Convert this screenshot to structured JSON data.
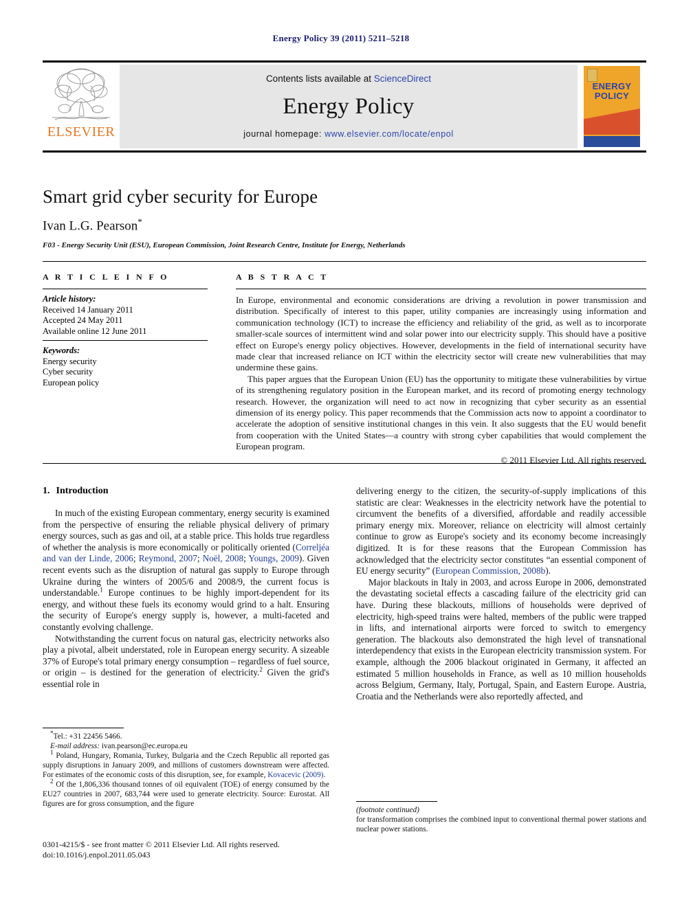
{
  "running_head": "Energy Policy 39 (2011) 5211–5218",
  "masthead": {
    "publisher_name": "ELSEVIER",
    "contents_prefix": "Contents lists available at ",
    "contents_link": "ScienceDirect",
    "journal_name": "Energy Policy",
    "homepage_prefix": "journal homepage: ",
    "homepage_url": "www.elsevier.com/locate/enpol",
    "cover_title_line1": "ENERGY",
    "cover_title_line2": "POLICY"
  },
  "article": {
    "title": "Smart grid cyber security for Europe",
    "author": "Ivan L.G. Pearson",
    "author_marker": "*",
    "affiliation": "F03 - Energy Security Unit (ESU), European Commission, Joint Research Centre, Institute for Energy, Netherlands"
  },
  "article_info": {
    "heading": "A R T I C L E  I N F O",
    "history_label": "Article history:",
    "history": [
      "Received 14 January 2011",
      "Accepted 24 May 2011",
      "Available online 12 June 2011"
    ],
    "keywords_label": "Keywords:",
    "keywords": [
      "Energy security",
      "Cyber security",
      "European policy"
    ]
  },
  "abstract": {
    "heading": "A B S T R A C T",
    "paragraph1": "In Europe, environmental and economic considerations are driving a revolution in power transmission and distribution. Specifically of interest to this paper, utility companies are increasingly using information and communication technology (ICT) to increase the efficiency and reliability of the grid, as well as to incorporate smaller-scale sources of intermittent wind and solar power into our electricity supply. This should have a positive effect on Europe's energy policy objectives. However, developments in the field of international security have made clear that increased reliance on ICT within the electricity sector will create new vulnerabilities that may undermine these gains.",
    "paragraph2": "This paper argues that the European Union (EU) has the opportunity to mitigate these vulnerabilities by virtue of its strengthening regulatory position in the European market, and its record of promoting energy technology research. However, the organization will need to act now in recognizing that cyber security as an essential dimension of its energy policy. This paper recommends that the Commission acts now to appoint a coordinator to accelerate the adoption of sensitive institutional changes in this vein. It also suggests that the EU would benefit from cooperation with the United States—a country with strong cyber capabilities that would complement the European program.",
    "copyright": "© 2011 Elsevier Ltd. All rights reserved."
  },
  "body": {
    "section_number": "1.",
    "section_title": "Introduction",
    "left_p1_a": "In much of the existing European commentary, energy security is examined from the perspective of ensuring the reliable physical delivery of primary energy sources, such as gas and oil, at a stable price. This holds true regardless of whether the analysis is more economically or politically oriented (",
    "left_p1_cite1": "Correljéa and van der Linde, 2006",
    "left_p1_sep1": "; ",
    "left_p1_cite2": "Reymond, 2007",
    "left_p1_sep2": "; ",
    "left_p1_cite3": "Noël, 2008",
    "left_p1_sep3": "; ",
    "left_p1_cite4": "Youngs, 2009",
    "left_p1_b": "). Given recent events such as the disruption of natural gas supply to Europe through Ukraine during the winters of 2005/6 and 2008/9, the current focus is understandable.",
    "left_p1_sup": "1",
    "left_p1_c": " Europe continues to be highly import-dependent for its energy, and without these fuels its economy would grind to a halt. Ensuring the security of Europe's energy supply is, however, a multi-faceted and constantly evolving challenge.",
    "left_p2_a": "Notwithstanding the current focus on natural gas, electricity networks also play a pivotal, albeit understated, role in European energy security. A sizeable 37% of Europe's total primary energy consumption – regardless of fuel source, or origin – is destined for the generation of electricity.",
    "left_p2_sup": "2",
    "left_p2_b": " Given the grid's essential role in",
    "right_p1_a": "delivering energy to the citizen, the security-of-supply implications of this statistic are clear: Weaknesses in the electricity network have the potential to circumvent the benefits of a diversified, affordable and readily accessible primary energy mix. Moreover, reliance on electricity will almost certainly continue to grow as Europe's society and its economy become increasingly digitized. It is for these reasons that the European Commission has acknowledged that the electricity sector constitutes “an essential component of EU energy security” (",
    "right_p1_cite": "European Commission, 2008b",
    "right_p1_b": ").",
    "right_p2": "Major blackouts in Italy in 2003, and across Europe in 2006, demonstrated the devastating societal effects a cascading failure of the electricity grid can have. During these blackouts, millions of households were deprived of electricity, high-speed trains were halted, members of the public were trapped in lifts, and international airports were forced to switch to emergency generation. The blackouts also demonstrated the high level of transnational interdependency that exists in the European electricity transmission system. For example, although the 2006 blackout originated in Germany, it affected an estimated 5 million households in France, as well as 10 million households across Belgium, Germany, Italy, Portugal, Spain, and Eastern Europe. Austria, Croatia and the Netherlands were also reportedly affected, and"
  },
  "footnotes": {
    "tel_marker": "*",
    "tel": "Tel.: +31 22456 5466.",
    "email_label": "E-mail address:",
    "email": "ivan.pearson@ec.europa.eu",
    "fn1_marker": "1",
    "fn1_a": "Poland, Hungary, Romania, Turkey, Bulgaria and the Czech Republic all reported gas supply disruptions in January 2009, and millions of customers downstream were affected. For estimates of the economic costs of this disruption, see, for example, ",
    "fn1_cite": "Kovacevic (2009)",
    "fn1_b": ".",
    "fn2_marker": "2",
    "fn2": "Of the 1,806,336 thousand tonnes of oil equivalent (TOE) of energy consumed by the EU27 countries in 2007, 683,744 were used to generate electricity. Source: Eurostat. All figures are for gross consumption, and the figure",
    "fn_continued_label": "(footnote continued)",
    "fn_continued": "for transformation comprises the combined input to conventional thermal power stations and nuclear power stations."
  },
  "imprint": {
    "line1": "0301-4215/$ - see front matter © 2011 Elsevier Ltd. All rights reserved.",
    "line2": "doi:10.1016/j.enpol.2011.05.043"
  },
  "colors": {
    "link": "#2b44a8",
    "citation": "#1f3a93",
    "running_head": "#1a1a6e",
    "elsevier_orange": "#E87722",
    "cover_bg": "#EFA42A",
    "cover_red": "#D9512C",
    "cover_blue": "#2B4C9B"
  }
}
